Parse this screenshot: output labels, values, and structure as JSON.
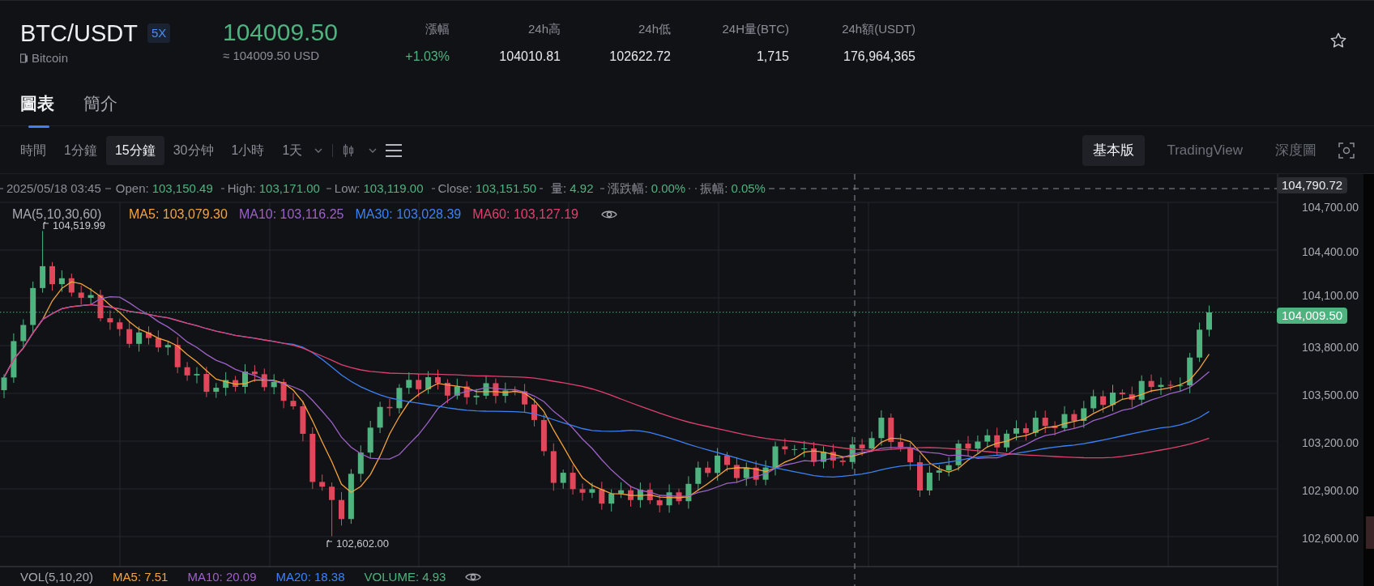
{
  "header": {
    "pair": "BTC/USDT",
    "leverage": "5X",
    "name": "Bitcoin",
    "price": "104009.50",
    "price_usd": "≈ 104009.50 USD",
    "stats": [
      {
        "label": "漲幅",
        "value": "+1.03%",
        "kind": "change"
      },
      {
        "label": "24h高",
        "value": "104010.81",
        "kind": "plain"
      },
      {
        "label": "24h低",
        "value": "102622.72",
        "kind": "plain"
      },
      {
        "label": "24H量(BTC)",
        "value": "1,715",
        "kind": "plain"
      },
      {
        "label": "24h額(USDT)",
        "value": "176,964,365",
        "kind": "plain"
      }
    ]
  },
  "tabs": [
    {
      "label": "圖表",
      "selected": true
    },
    {
      "label": "簡介",
      "selected": false
    }
  ],
  "intervals": [
    {
      "label": "時間",
      "selected": false
    },
    {
      "label": "1分鐘",
      "selected": false
    },
    {
      "label": "15分鐘",
      "selected": true
    },
    {
      "label": "30分钟",
      "selected": false
    },
    {
      "label": "1小時",
      "selected": false
    },
    {
      "label": "1天",
      "selected": false
    }
  ],
  "chart_views": [
    {
      "label": "基本版",
      "selected": true
    },
    {
      "label": "TradingView",
      "selected": false
    },
    {
      "label": "深度圖",
      "selected": false
    }
  ],
  "chart": {
    "crosshair_time": "2025/05/18 03:45",
    "crosshair_fields": [
      {
        "label": "Open:",
        "value": "103,150.49"
      },
      {
        "label": "High:",
        "value": "103,171.00"
      },
      {
        "label": "Low:",
        "value": "103,119.00"
      },
      {
        "label": "Close:",
        "value": "103,151.50"
      },
      {
        "label": "量:",
        "value": "4.92"
      },
      {
        "label": "漲跌幅:",
        "value": "0.00%"
      },
      {
        "label": "振幅:",
        "value": "0.05%"
      }
    ],
    "ma_title": "MA(5,10,30,60)",
    "ma_items": [
      {
        "label": "MA5: 103,079.30",
        "color": "#f5a33b"
      },
      {
        "label": "MA10: 103,116.25",
        "color": "#9d62c6"
      },
      {
        "label": "MA30: 103,028.39",
        "color": "#3b82f6"
      },
      {
        "label": "MA60: 103,127.19",
        "color": "#e0406e"
      }
    ],
    "high_marker": "104,519.99",
    "low_marker": "102,602.00",
    "y_ticks": [
      "104,700.00",
      "104,400.00",
      "104,100.00",
      "103,800.00",
      "103,500.00",
      "103,200.00",
      "102,900.00",
      "102,600.00"
    ],
    "crosshair_price": "104,790.72",
    "last_price": "104,009.50",
    "vol_title": "VOL(5,10,20)",
    "vol_items": [
      {
        "label": "MA5: 7.51",
        "color": "#f5a33b"
      },
      {
        "label": "MA10: 20.09",
        "color": "#9d62c6"
      },
      {
        "label": "MA20: 18.38",
        "color": "#3b82f6"
      },
      {
        "label": "VOLUME: 4.93",
        "color": "#4fb37f"
      }
    ]
  }
}
